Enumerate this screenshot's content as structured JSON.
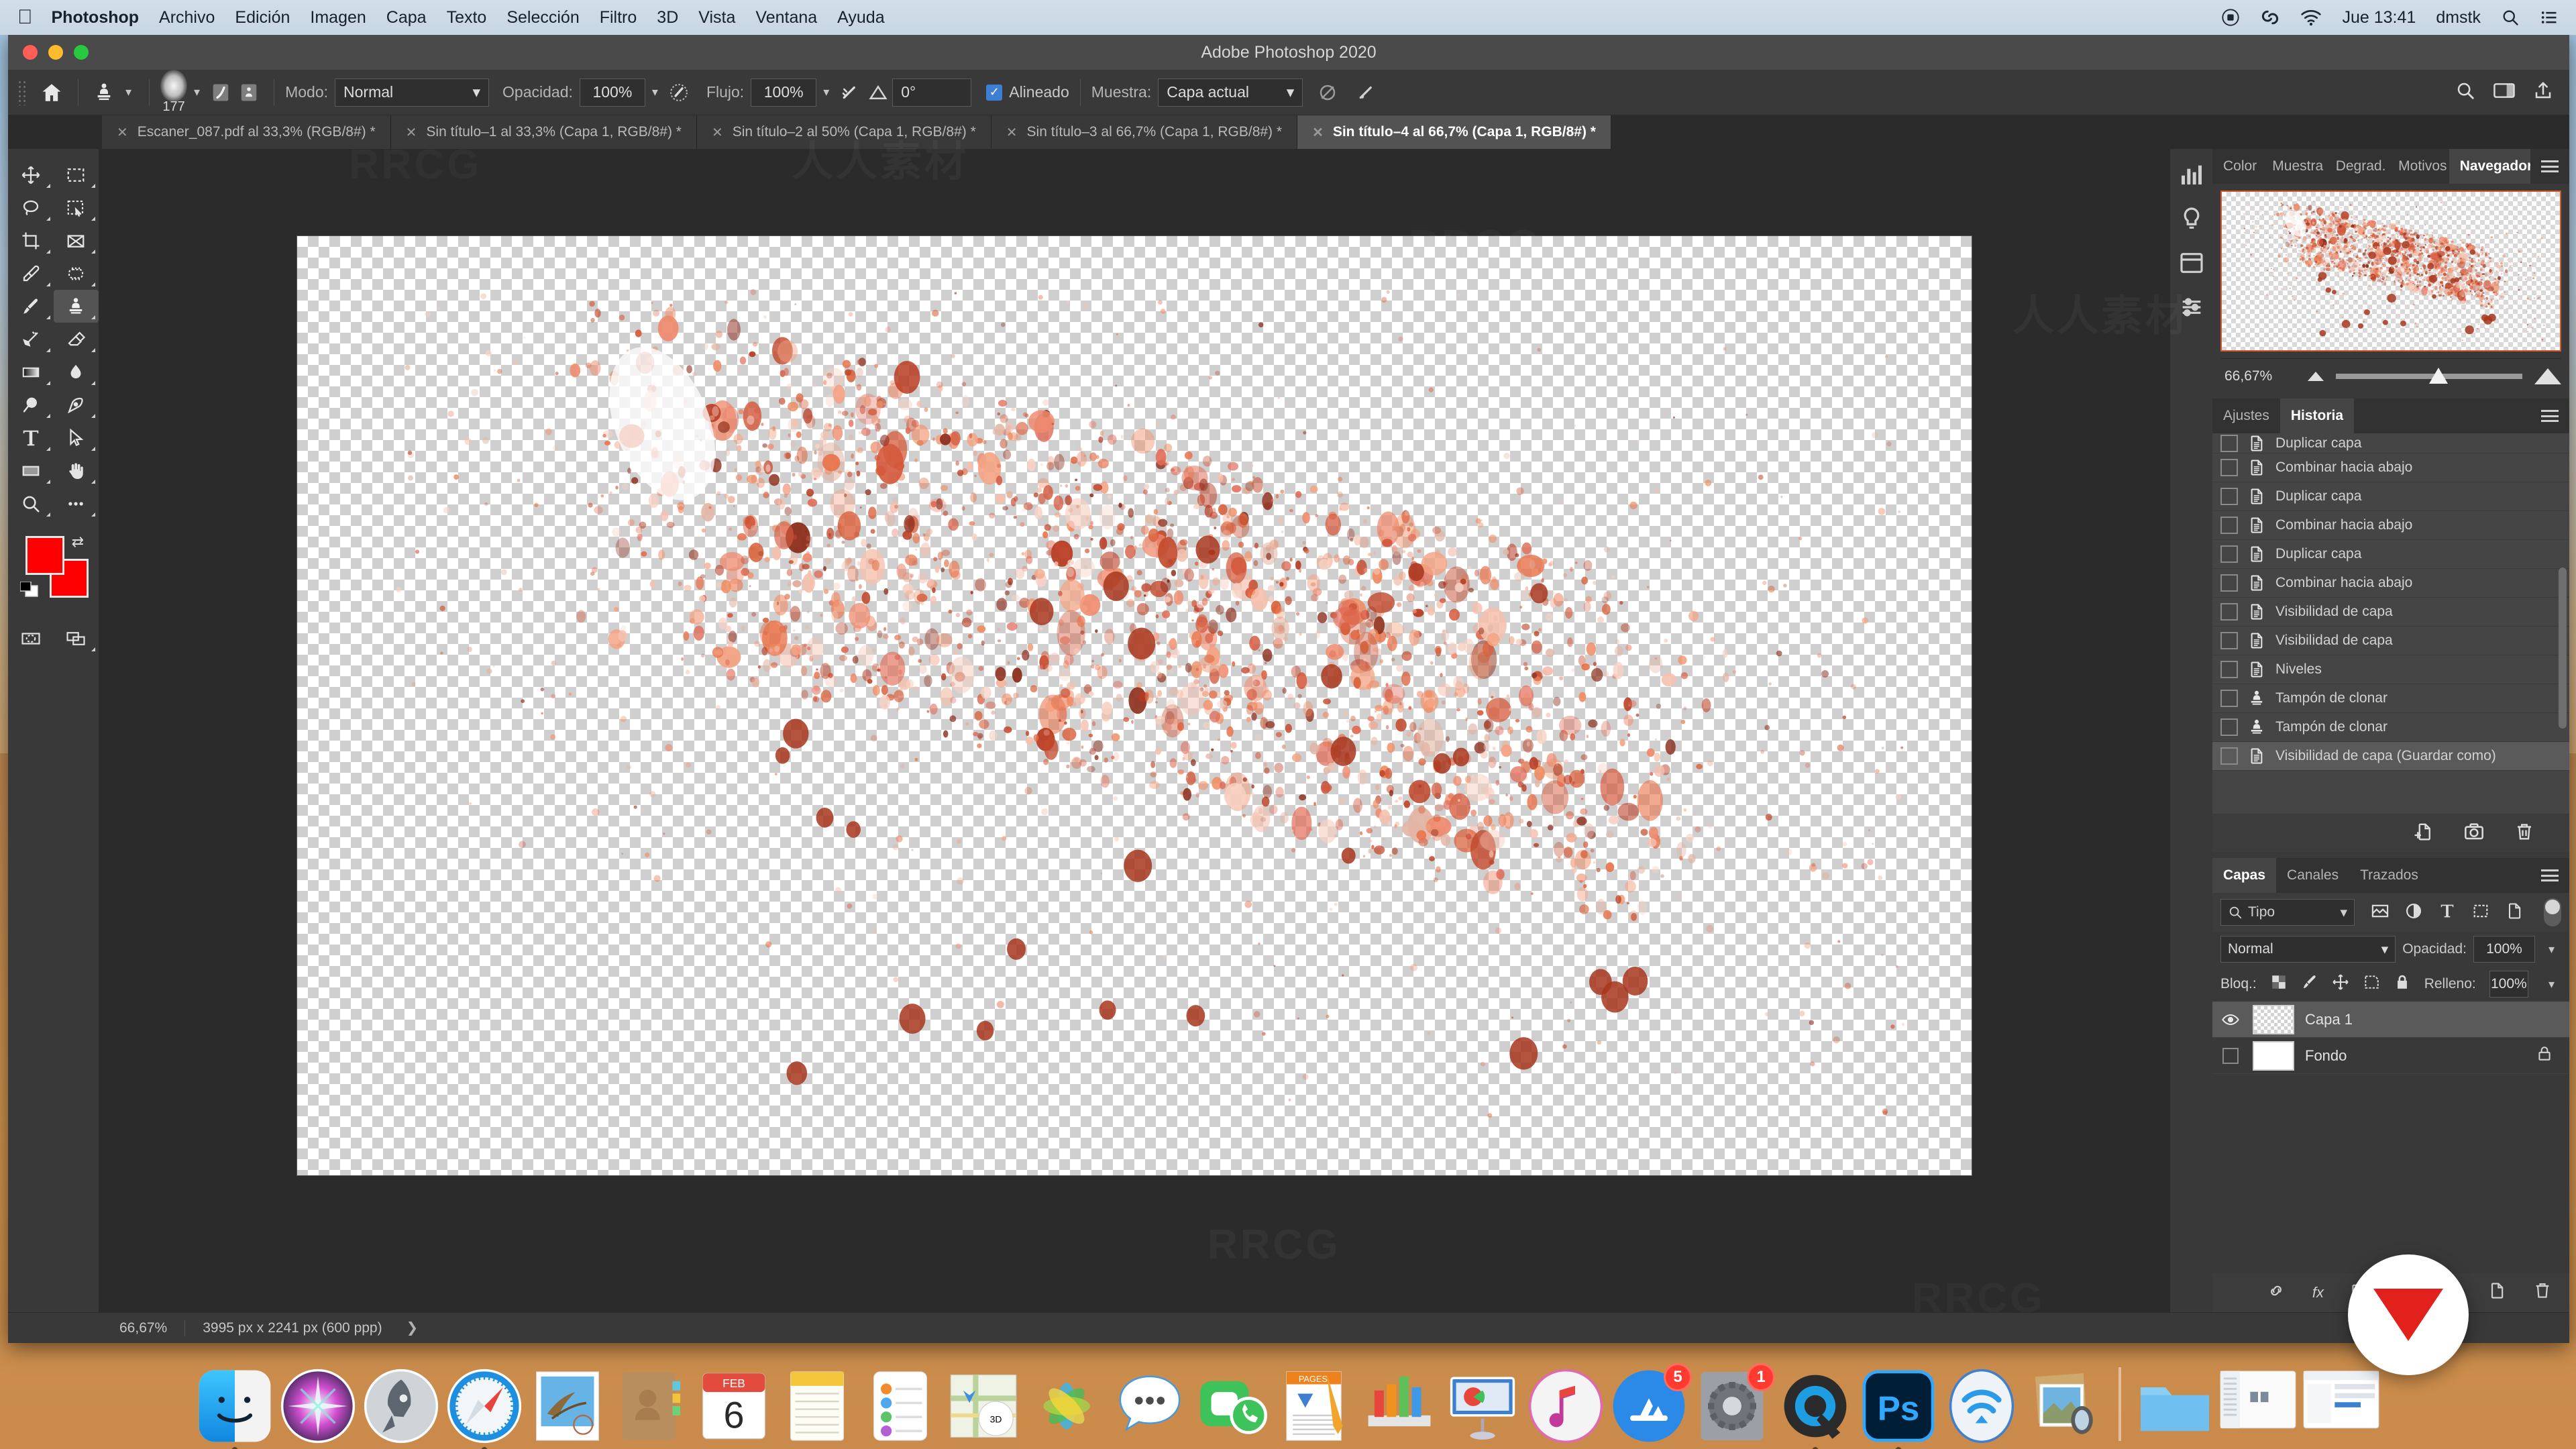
{
  "menubar": {
    "apple_icon": "apple-icon",
    "items": [
      {
        "label": "Photoshop",
        "bold": true
      },
      {
        "label": "Archivo",
        "bold": false
      },
      {
        "label": "Edición",
        "bold": false
      },
      {
        "label": "Imagen",
        "bold": false
      },
      {
        "label": "Capa",
        "bold": false
      },
      {
        "label": "Texto",
        "bold": false
      },
      {
        "label": "Selección",
        "bold": false
      },
      {
        "label": "Filtro",
        "bold": false
      },
      {
        "label": "3D",
        "bold": false
      },
      {
        "label": "Vista",
        "bold": false
      },
      {
        "label": "Ventana",
        "bold": false
      },
      {
        "label": "Ayuda",
        "bold": false
      }
    ],
    "right": {
      "screen_record_icon": "record-icon",
      "creative_cloud_icon": "creative-cloud-icon",
      "wifi_icon": "wifi-icon",
      "clock": "Jue 13:41",
      "user": "dmstk",
      "search_icon": "search-icon",
      "control_center_icon": "control-center-icon"
    }
  },
  "window": {
    "title": "Adobe Photoshop 2020"
  },
  "options_bar": {
    "home_icon": "home-icon",
    "tool_icon": "clone-stamp-icon",
    "brush_size": "177",
    "brush_panel_icon": "brush-settings-icon",
    "clone_source_icon": "clone-source-icon",
    "mode_label": "Modo:",
    "mode_value": "Normal",
    "opacity_label": "Opacidad:",
    "opacity_value": "100%",
    "pressure_opacity_icon": "pressure-opacity-icon",
    "flow_label": "Flujo:",
    "flow_value": "100%",
    "airbrush_icon": "airbrush-icon",
    "angle_icon": "angle-icon",
    "angle_value": "0°",
    "aligned_label": "Alineado",
    "aligned_checked": true,
    "sample_label": "Muestra:",
    "sample_value": "Capa actual",
    "ignore_adjust_icon": "ignore-adjustment-icon",
    "tablet_pressure_icon": "tablet-pressure-icon",
    "right_icons": [
      "search-icon",
      "workspace-icon",
      "share-icon"
    ]
  },
  "tabs": [
    {
      "label": "Escaner_087.pdf al 33,3% (RGB/8#) *",
      "active": false
    },
    {
      "label": "Sin título–1 al 33,3% (Capa 1, RGB/8#) *",
      "active": false
    },
    {
      "label": "Sin título–2 al 50% (Capa 1, RGB/8#) *",
      "active": false
    },
    {
      "label": "Sin título–3 al 66,7% (Capa 1, RGB/8#) *",
      "active": false
    },
    {
      "label": "Sin título–4 al 66,7% (Capa 1, RGB/8#) *",
      "active": true
    }
  ],
  "toolbar": {
    "tools": [
      {
        "name": "move-tool",
        "active": false
      },
      {
        "name": "rectangular-marquee-tool",
        "active": false
      },
      {
        "name": "lasso-tool",
        "active": false
      },
      {
        "name": "quick-selection-tool",
        "active": false
      },
      {
        "name": "crop-tool",
        "active": false
      },
      {
        "name": "frame-tool",
        "active": false
      },
      {
        "name": "eyedropper-tool",
        "active": false
      },
      {
        "name": "spot-healing-brush-tool",
        "active": false
      },
      {
        "name": "brush-tool",
        "active": false
      },
      {
        "name": "clone-stamp-tool",
        "active": true
      },
      {
        "name": "history-brush-tool",
        "active": false
      },
      {
        "name": "eraser-tool",
        "active": false
      },
      {
        "name": "gradient-tool",
        "active": false
      },
      {
        "name": "blur-tool",
        "active": false
      },
      {
        "name": "dodge-tool",
        "active": false
      },
      {
        "name": "pen-tool",
        "active": false
      },
      {
        "name": "type-tool",
        "active": false
      },
      {
        "name": "path-selection-tool",
        "active": false
      },
      {
        "name": "rectangle-tool",
        "active": false
      },
      {
        "name": "hand-tool",
        "active": false
      },
      {
        "name": "zoom-tool",
        "active": false
      },
      {
        "name": "edit-toolbar-tool",
        "active": false
      }
    ],
    "foreground_color": "#ff0000",
    "background_color": "#ff0000",
    "quick-mask-icon": "quick-mask-icon",
    "screen-mode-icon": "screen-mode-icon"
  },
  "statusbar": {
    "zoom": "66,67%",
    "dimensions": "3995 px x 2241 px (600 ppp)",
    "arrow": "❯"
  },
  "rail_icons": [
    "histogram-icon",
    "lightbulb-icon",
    "libraries-icon",
    "adjustments-icon"
  ],
  "panel_group_top": {
    "tabs": [
      {
        "label": "Color",
        "active": false
      },
      {
        "label": "Muestra",
        "active": false
      },
      {
        "label": "Degrad.",
        "active": false
      },
      {
        "label": "Motivos",
        "active": false
      },
      {
        "label": "Navegador",
        "active": true
      }
    ],
    "menu_icon": "panel-menu-icon"
  },
  "navigator": {
    "zoom_value": "66,67%",
    "small_mountain_icon": "zoom-out-icon",
    "large_mountain_icon": "zoom-in-icon",
    "slider_position_pct": 52
  },
  "panel_group_history": {
    "tabs": [
      {
        "label": "Ajustes",
        "active": false
      },
      {
        "label": "Historia",
        "active": true
      }
    ],
    "menu_icon": "panel-menu-icon"
  },
  "history": {
    "items": [
      {
        "label": "Duplicar capa",
        "icon": "document-state-icon",
        "selected": false,
        "partial": true
      },
      {
        "label": "Combinar hacia abajo",
        "icon": "document-state-icon",
        "selected": false
      },
      {
        "label": "Duplicar capa",
        "icon": "document-state-icon",
        "selected": false
      },
      {
        "label": "Combinar hacia abajo",
        "icon": "document-state-icon",
        "selected": false
      },
      {
        "label": "Duplicar capa",
        "icon": "document-state-icon",
        "selected": false
      },
      {
        "label": "Combinar hacia abajo",
        "icon": "document-state-icon",
        "selected": false
      },
      {
        "label": "Visibilidad de capa",
        "icon": "document-state-icon",
        "selected": false
      },
      {
        "label": "Visibilidad de capa",
        "icon": "document-state-icon",
        "selected": false
      },
      {
        "label": "Niveles",
        "icon": "document-state-icon",
        "selected": false
      },
      {
        "label": "Tampón de clonar",
        "icon": "clone-stamp-icon",
        "selected": false
      },
      {
        "label": "Tampón de clonar",
        "icon": "clone-stamp-icon",
        "selected": false
      },
      {
        "label": "Visibilidad de capa (Guardar como)",
        "icon": "document-state-icon",
        "selected": true
      }
    ],
    "footer_icons": [
      "new-document-from-state-icon",
      "new-snapshot-icon",
      "delete-state-icon"
    ]
  },
  "panel_group_layers": {
    "tabs": [
      {
        "label": "Capas",
        "active": true
      },
      {
        "label": "Canales",
        "active": false
      },
      {
        "label": "Trazados",
        "active": false
      }
    ],
    "menu_icon": "panel-menu-icon"
  },
  "layers": {
    "filter_label": "Tipo",
    "filter_icons": [
      "filter-pixel-icon",
      "filter-adjustment-icon",
      "filter-type-icon",
      "filter-shape-icon",
      "filter-smart-object-icon"
    ],
    "blend_mode": "Normal",
    "opacity_label": "Opacidad:",
    "opacity_value": "100%",
    "lock_label": "Bloq.:",
    "lock_icons": [
      "lock-transparent-pixels-icon",
      "lock-image-pixels-icon",
      "lock-position-icon",
      "lock-artboard-icon",
      "lock-all-icon"
    ],
    "fill_label": "Relleno:",
    "fill_value": "100%",
    "rows": [
      {
        "name": "Capa 1",
        "visible": true,
        "selected": true,
        "thumb": "checker",
        "locked": false
      },
      {
        "name": "Fondo",
        "visible": false,
        "selected": false,
        "thumb": "white",
        "locked": true
      }
    ],
    "footer_icons": [
      "link-layers-icon",
      "fx-icon",
      "layer-mask-icon",
      "new-group-icon",
      "new-layer-icon",
      "delete-layer-icon"
    ],
    "fx_label": "fx"
  },
  "dock": {
    "items": [
      {
        "name": "finder",
        "running": true
      },
      {
        "name": "siri",
        "running": false
      },
      {
        "name": "launchpad",
        "running": false
      },
      {
        "name": "safari",
        "running": true
      },
      {
        "name": "mail",
        "running": false
      },
      {
        "name": "contacts",
        "running": false
      },
      {
        "name": "calendar",
        "running": false,
        "badge": null,
        "day": "6",
        "month": "FEB"
      },
      {
        "name": "notes",
        "running": false
      },
      {
        "name": "reminders",
        "running": false
      },
      {
        "name": "maps",
        "running": false
      },
      {
        "name": "photos",
        "running": false
      },
      {
        "name": "messages",
        "running": false
      },
      {
        "name": "facetime",
        "running": false
      },
      {
        "name": "pages",
        "running": false
      },
      {
        "name": "numbers",
        "running": false
      },
      {
        "name": "keynote",
        "running": false
      },
      {
        "name": "itunes",
        "running": false
      },
      {
        "name": "app-store",
        "running": false,
        "badge": "5"
      },
      {
        "name": "system-preferences",
        "running": false,
        "badge": "1"
      },
      {
        "name": "quicktime",
        "running": true
      },
      {
        "name": "photoshop",
        "running": true
      },
      {
        "name": "airdrop",
        "running": false
      },
      {
        "name": "preview",
        "running": false
      }
    ],
    "minimized": [
      {
        "name": "downloads-folder"
      },
      {
        "name": "finder-window-thumb"
      },
      {
        "name": "safari-window-thumb"
      }
    ]
  },
  "watermarks": [
    "RRCG",
    "人人素材",
    "RRCG",
    "人人素材",
    "RRCG"
  ],
  "chart_data": null
}
